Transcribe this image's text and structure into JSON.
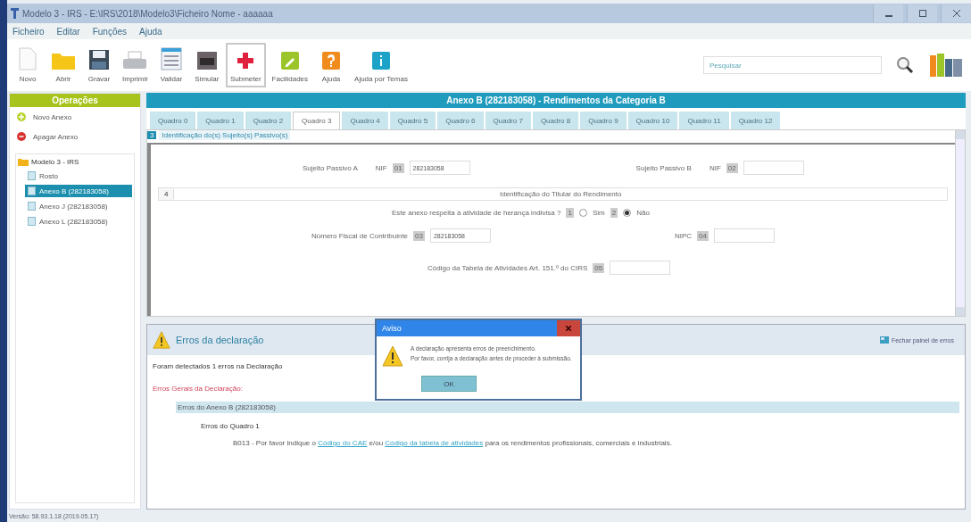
{
  "window": {
    "title": "Modelo 3 - IRS - E:\\IRS\\2018\\Modelo3\\Ficheiro Nome - aaaaaa"
  },
  "menu": [
    "Ficheiro",
    "Editar",
    "Funções",
    "Ajuda"
  ],
  "toolbar": [
    {
      "label": "Novo",
      "selected": false
    },
    {
      "label": "Abrir",
      "selected": false
    },
    {
      "label": "Gravar",
      "selected": false
    },
    {
      "label": "Imprimir",
      "selected": false
    },
    {
      "label": "Validar",
      "selected": false
    },
    {
      "label": "Simular",
      "selected": false
    },
    {
      "label": "Submeter",
      "selected": true
    },
    {
      "label": "Facilidades",
      "selected": false
    },
    {
      "label": "Ajuda",
      "selected": false
    },
    {
      "label": "Ajuda por Temas",
      "selected": false
    }
  ],
  "search": {
    "placeholder": "Pesquisar"
  },
  "sidebar": {
    "title": "Operações",
    "actions": [
      "Novo Anexo",
      "Apagar Anexo"
    ],
    "tree": {
      "label": "Modelo 3 - IRS",
      "children": [
        {
          "label": "Rosto",
          "selected": false
        },
        {
          "label": "Anexo B (282183058)",
          "selected": true
        },
        {
          "label": "Anexo J (282183058)",
          "selected": false
        },
        {
          "label": "Anexo L (282183058)",
          "selected": false
        }
      ]
    }
  },
  "annex": {
    "title": "Anexo B (282183058) - Rendimentos da Categoria B",
    "tabs": [
      {
        "label": "Quadro 0",
        "selected": false
      },
      {
        "label": "Quadro 1",
        "selected": false
      },
      {
        "label": "Quadro 2",
        "selected": false
      },
      {
        "label": "Quadro 3",
        "selected": true
      },
      {
        "label": "Quadro 4",
        "selected": false
      },
      {
        "label": "Quadro 5",
        "selected": false
      },
      {
        "label": "Quadro 6",
        "selected": false
      },
      {
        "label": "Quadro 7",
        "selected": false
      },
      {
        "label": "Quadro 8",
        "selected": false
      },
      {
        "label": "Quadro 9",
        "selected": false
      },
      {
        "label": "Quadro 10",
        "selected": false
      },
      {
        "label": "Quadro 11",
        "selected": false
      },
      {
        "label": "Quadro 12",
        "selected": false
      }
    ]
  },
  "form": {
    "section_number": "3",
    "section_title": "Identificação do(s) Sujeito(s) Passivo(s)",
    "subjects": [
      {
        "label": "Sujeito Passivo A",
        "prefix": "NIF",
        "code": "01",
        "value": "282183058"
      },
      {
        "label": "Sujeito Passivo B",
        "prefix": "NIF",
        "code": "02"
      }
    ],
    "titular": {
      "number": "4",
      "title": "Identificação do Titular do Rendimento"
    },
    "question": {
      "label": "Este anexo respeita à atividade de herança indivisa ?",
      "options": [
        {
          "code": "1",
          "label": "Sim",
          "selected": false
        },
        {
          "code": "2",
          "label": "Não",
          "selected": true
        }
      ]
    },
    "nif": {
      "label": "Número Fiscal de Contribuinte",
      "code": "03",
      "value": "282183058"
    },
    "nipc": {
      "label": "NIPC",
      "code": "04"
    },
    "cae": {
      "label": "Código da Tabela de Atividades Art. 151.º do CIRS",
      "code": "05"
    }
  },
  "errors": {
    "title": "Erros da declaração",
    "close_label": "Fechar painel de erros",
    "summary": "Foram detectados 1 erros na Declaração",
    "general_title": "Erros Gerais da Declaração:",
    "annex_title": "Erros do Anexo B (282183058)",
    "quadro_title": "Erros do Quadro 1",
    "message": {
      "start": "B013 - Por favor indique o ",
      "link1": "Código do CAE",
      "mid": " e/ou ",
      "link2": "Código da tabela de atividades",
      "end": " para os rendimentos profissionais, comerciais e industriais."
    }
  },
  "dialog": {
    "title": "Aviso",
    "lines": [
      "A declaração apresenta erros de preenchimento.",
      "Por favor, corrija a declaração antes de proceder à submissão."
    ],
    "button": "OK"
  },
  "status_bar": "Versão: 58.93.1.18 (2019.05.17)"
}
